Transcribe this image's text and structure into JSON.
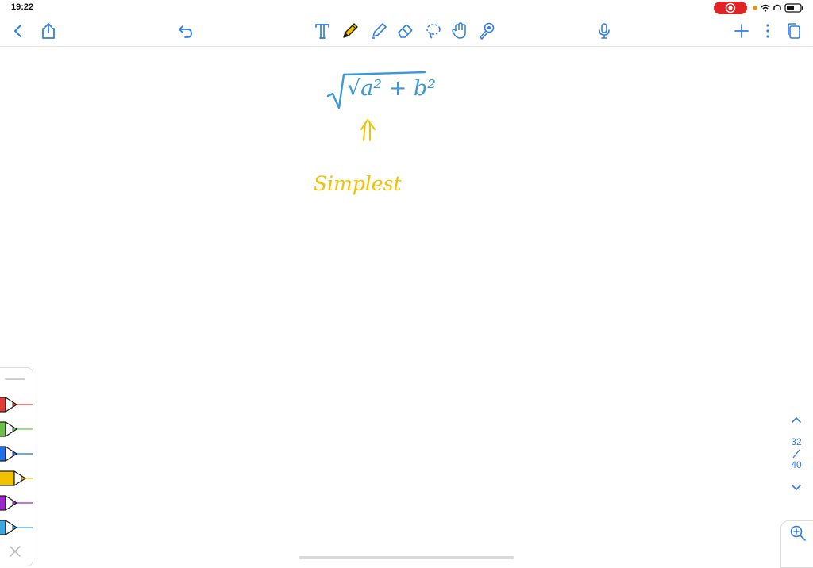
{
  "status_bar": {
    "time": "19:22"
  },
  "toolbar": {
    "left_icons": [
      "back-icon",
      "share-icon",
      "undo-icon"
    ],
    "tools": [
      "text-tool-icon",
      "pen-tool-icon",
      "highlighter-tool-icon",
      "eraser-tool-icon",
      "lasso-tool-icon",
      "hand-tool-icon",
      "laser-pointer-icon"
    ],
    "right_icons": [
      "microphone-icon",
      "add-page-icon",
      "more-icon",
      "pages-icon"
    ],
    "accent": "#2f7ee6",
    "active_pen_color": "#f2c200"
  },
  "canvas": {
    "formula_text": "√a² + b²",
    "formula_color": "#3a9ad9",
    "arrow_glyph": "⇑",
    "note_text": "Simplest",
    "note_color": "#f2c200"
  },
  "pen_palette": {
    "pens": [
      {
        "name": "red",
        "color": "#e53935"
      },
      {
        "name": "green",
        "color": "#6cc04a"
      },
      {
        "name": "blue",
        "color": "#1e6fe8"
      },
      {
        "name": "yellow",
        "color": "#f2c200"
      },
      {
        "name": "purple",
        "color": "#9b27c9"
      },
      {
        "name": "light-blue",
        "color": "#3aa7e0"
      }
    ]
  },
  "pager": {
    "current": "32",
    "separator": "/",
    "total": "40"
  }
}
